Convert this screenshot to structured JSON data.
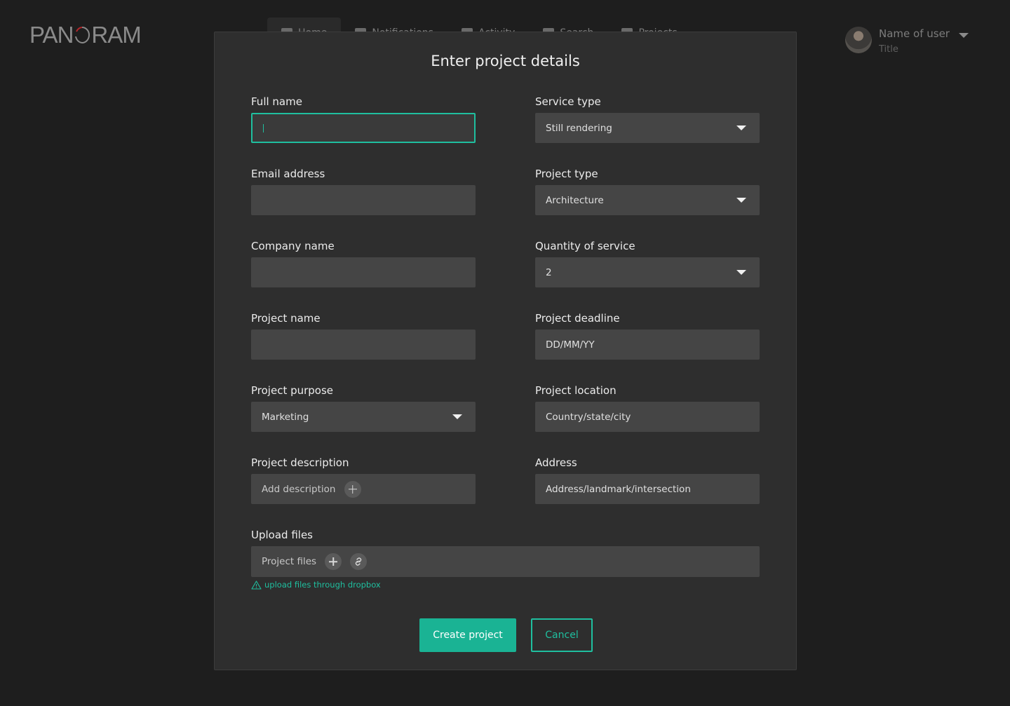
{
  "app": {
    "logo_left": "PAN",
    "logo_right": "RAM",
    "accent_color": "#1ab394",
    "logo_accent_color": "#b3262a"
  },
  "nav": {
    "items": [
      {
        "label": "Home",
        "icon": "home-icon"
      },
      {
        "label": "Notifications",
        "icon": "bell-icon"
      },
      {
        "label": "Activity",
        "icon": "activity-icon"
      },
      {
        "label": "Search",
        "icon": "search-icon"
      },
      {
        "label": "Projects",
        "icon": "folder-icon"
      }
    ]
  },
  "user": {
    "name": "Name of user",
    "title": "Title"
  },
  "modal": {
    "title": "Enter project details",
    "fields": {
      "full_name": {
        "label": "Full name",
        "value": ""
      },
      "email": {
        "label": "Email address",
        "value": ""
      },
      "company": {
        "label": "Company name",
        "value": ""
      },
      "project_name": {
        "label": "Project name",
        "value": ""
      },
      "project_purpose": {
        "label": "Project purpose",
        "value": "Marketing"
      },
      "project_description": {
        "label": "Project description",
        "value": "Add description"
      },
      "service_type": {
        "label": "Service type",
        "value": "Still rendering"
      },
      "project_type": {
        "label": "Project type",
        "value": "Architecture"
      },
      "quantity": {
        "label": "Quantity of service",
        "value": "2"
      },
      "deadline": {
        "label": "Project deadline",
        "value": "DD/MM/YY"
      },
      "location": {
        "label": "Project location",
        "value": "Country/state/city"
      },
      "address": {
        "label": "Address",
        "value": "Address/landmark/intersection"
      },
      "upload": {
        "label": "Upload files",
        "value": "Project files"
      }
    },
    "warning": "upload files through dropbox",
    "create_label": "Create project",
    "cancel_label": "Cancel"
  }
}
